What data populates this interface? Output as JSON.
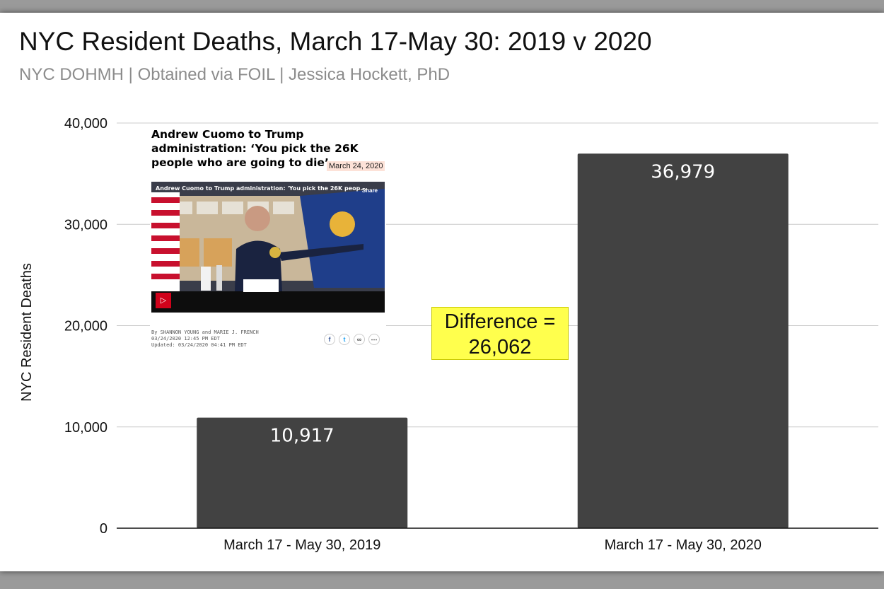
{
  "title": "NYC Resident Deaths, March 17-May 30: 2019 v 2020",
  "subtitle": "NYC DOHMH | Obtained via FOIL | Jessica Hockett, PhD",
  "chart_data": {
    "type": "bar",
    "title": "NYC Resident Deaths, March 17-May 30: 2019 v 2020",
    "subtitle": "NYC DOHMH | Obtained via FOIL | Jessica Hockett, PhD",
    "categories": [
      "March 17 - May 30, 2019",
      "March 17 - May 30, 2020"
    ],
    "values": [
      10917,
      36979
    ],
    "value_labels": [
      "10,917",
      "36,979"
    ],
    "ylabel": "NYC Resident Deaths",
    "xlabel": "",
    "ylim": [
      0,
      40000
    ],
    "yticks": [
      0,
      10000,
      20000,
      30000,
      40000
    ],
    "ytick_labels": [
      "0",
      "10,000",
      "20,000",
      "30,000",
      "40,000"
    ],
    "grid": true,
    "bar_color": "#424242",
    "annotation": {
      "line1": "Difference =",
      "line2": "26,062",
      "color": "#ffff4d"
    }
  },
  "inset_article": {
    "headline": "Andrew Cuomo to Trump administration: ‘You pick the 26K people who are going to die’",
    "date": "March 24, 2020",
    "video_title": "Andrew Cuomo to Trump administration: 'You pick the 26K peop...",
    "share_label": "Share",
    "byline": "By SHANNON YOUNG and MARIE J. FRENCH",
    "published": "03/24/2020 12:45 PM EDT",
    "updated": "Updated: 03/24/2020 04:41 PM EDT",
    "icons": [
      "facebook-icon",
      "twitter-icon",
      "link-icon",
      "more-icon"
    ]
  }
}
